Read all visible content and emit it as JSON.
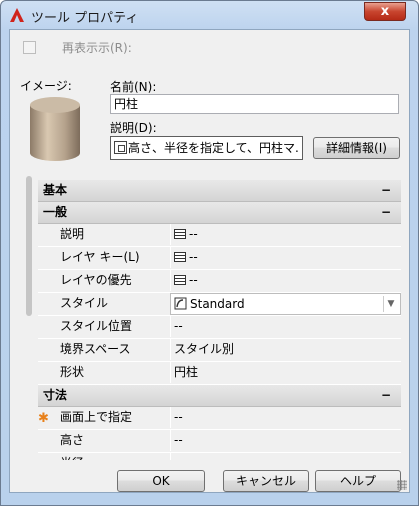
{
  "window": {
    "title": "ツール プロパティ",
    "close_label": "x"
  },
  "redisplay_label": "再表示示(R):",
  "image_label": "イメージ:",
  "name_label": "名前(N):",
  "name_value": "円柱",
  "description_label": "説明(D):",
  "description_value": "高さ、半径を指定して、円柱マ.",
  "detail_button": "詳細情報(I)",
  "categories": [
    {
      "name": "基本",
      "collapse": "−"
    },
    {
      "name": "一般",
      "collapse": "−"
    },
    {
      "name": "寸法",
      "collapse": "−"
    }
  ],
  "general_rows": [
    {
      "key": "説明",
      "value": "--",
      "icon": "table-icon"
    },
    {
      "key": "レイヤ キー(L)",
      "value": "--",
      "icon": "table-icon"
    },
    {
      "key": "レイヤの優先",
      "value": "--",
      "icon": "table-icon"
    },
    {
      "key": "スタイル",
      "value": "Standard",
      "icon": "style-icon"
    },
    {
      "key": "スタイル位置",
      "value": "--"
    },
    {
      "key": "境界スペース",
      "value": "スタイル別"
    },
    {
      "key": "形状",
      "value": "円柱"
    }
  ],
  "dimension_rows": [
    {
      "key": "画面上で指定",
      "value": "--",
      "marker": "✱"
    },
    {
      "key": "高さ",
      "value": "--"
    },
    {
      "key": "半径",
      "value": "--"
    }
  ],
  "buttons": {
    "ok": "OK",
    "cancel": "キャンセル",
    "help": "ヘルプ"
  }
}
